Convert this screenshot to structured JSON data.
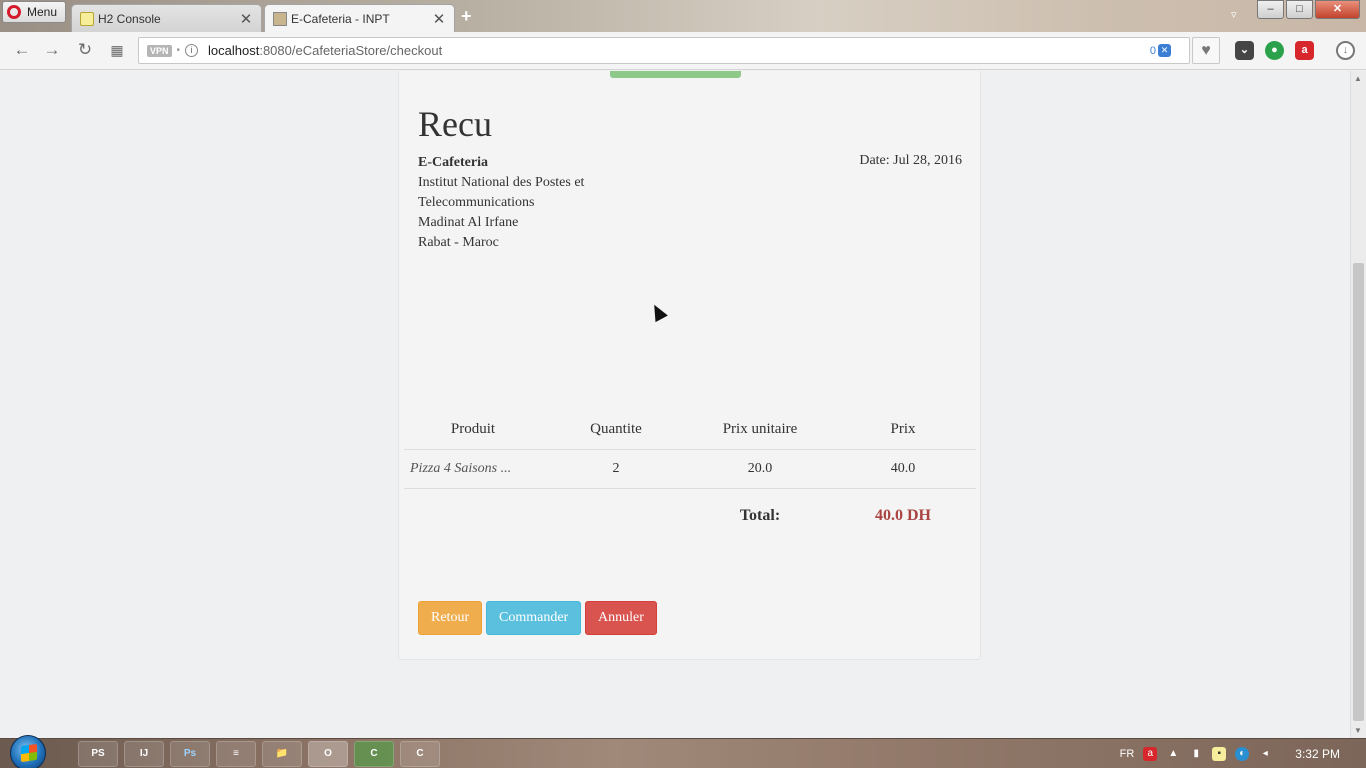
{
  "browser": {
    "menu_label": "Menu",
    "tabs": [
      {
        "title": "H2 Console",
        "favicon": "h2-favicon",
        "active": false
      },
      {
        "title": "E-Cafeteria - INPT",
        "favicon": "cafeteria-favicon",
        "active": true
      }
    ],
    "address": {
      "vpn_label": "VPN",
      "url_host": "localhost",
      "url_path": ":8080/eCafeteriaStore/checkout",
      "adblock_count": "0"
    },
    "window_controls": {
      "minimize": "‒",
      "maximize": "□",
      "close": "✕"
    }
  },
  "receipt": {
    "title": "Recu",
    "company": {
      "name": "E-Cafeteria",
      "line1": "Institut National des Postes et",
      "line2": "Telecommunications",
      "line3": "Madinat Al Irfane",
      "line4": "Rabat - Maroc"
    },
    "date": "Date: Jul 28, 2016",
    "table": {
      "headers": [
        "Produit",
        "Quantite",
        "Prix unitaire",
        "Prix"
      ],
      "rows": [
        {
          "product": "Pizza 4 Saisons ...",
          "quantity": "2",
          "unit_price": "20.0",
          "price": "40.0"
        }
      ],
      "total_label": "Total:",
      "total_value": "40.0 DH"
    },
    "buttons": {
      "back": "Retour",
      "order": "Commander",
      "cancel": "Annuler"
    }
  },
  "taskbar": {
    "items": [
      "PS",
      "IJ",
      "Ps",
      "≡",
      "📁",
      "O",
      "C",
      "C"
    ],
    "language": "FR",
    "time": "3:32 PM"
  },
  "colors": {
    "warning": "#f0ad4e",
    "info": "#5bc0de",
    "danger": "#d9534f",
    "total": "#a94442"
  }
}
